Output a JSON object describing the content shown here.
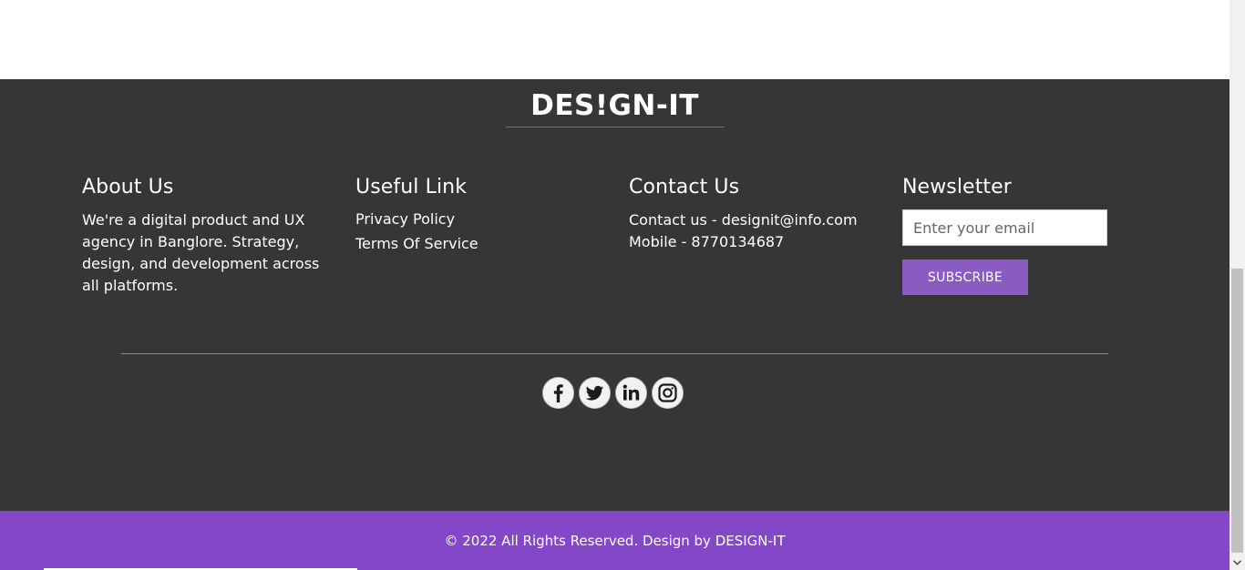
{
  "brand": {
    "name": "DES!GN-IT"
  },
  "about": {
    "title": "About Us",
    "text": "We're a digital product and UX agency in Banglore. Strategy, design, and development across all platforms."
  },
  "useful": {
    "title": "Useful Link",
    "links": [
      "Privacy Policy",
      "Terms Of Service"
    ]
  },
  "contact": {
    "title": "Contact Us",
    "email_line": "Contact us - designit@info.com",
    "mobile_line": "Mobile - 8770134687"
  },
  "newsletter": {
    "title": "Newsletter",
    "placeholder": "Enter your email",
    "button": "SUBSCRIBE"
  },
  "socials": [
    "facebook-icon",
    "twitter-icon",
    "linkedin-icon",
    "instagram-icon"
  ],
  "copyright": "© 2022 All Rights Reserved. Design by DESIGN-IT",
  "colors": {
    "footer_bg": "#363636",
    "accent": "#8447c8",
    "button": "#8a5cc2"
  }
}
